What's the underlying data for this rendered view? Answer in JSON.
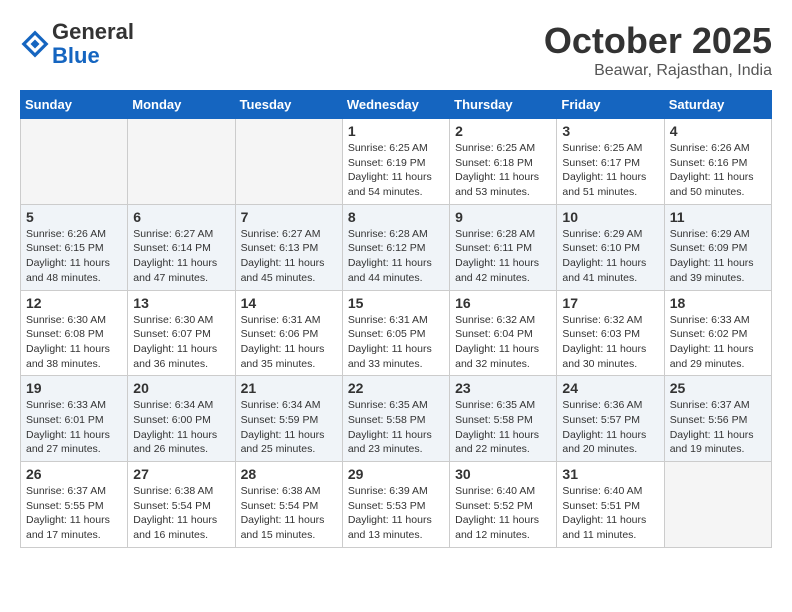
{
  "header": {
    "logo_general": "General",
    "logo_blue": "Blue",
    "month_title": "October 2025",
    "location": "Beawar, Rajasthan, India"
  },
  "weekdays": [
    "Sunday",
    "Monday",
    "Tuesday",
    "Wednesday",
    "Thursday",
    "Friday",
    "Saturday"
  ],
  "weeks": [
    [
      {
        "day": "",
        "info": ""
      },
      {
        "day": "",
        "info": ""
      },
      {
        "day": "",
        "info": ""
      },
      {
        "day": "1",
        "info": "Sunrise: 6:25 AM\nSunset: 6:19 PM\nDaylight: 11 hours\nand 54 minutes."
      },
      {
        "day": "2",
        "info": "Sunrise: 6:25 AM\nSunset: 6:18 PM\nDaylight: 11 hours\nand 53 minutes."
      },
      {
        "day": "3",
        "info": "Sunrise: 6:25 AM\nSunset: 6:17 PM\nDaylight: 11 hours\nand 51 minutes."
      },
      {
        "day": "4",
        "info": "Sunrise: 6:26 AM\nSunset: 6:16 PM\nDaylight: 11 hours\nand 50 minutes."
      }
    ],
    [
      {
        "day": "5",
        "info": "Sunrise: 6:26 AM\nSunset: 6:15 PM\nDaylight: 11 hours\nand 48 minutes."
      },
      {
        "day": "6",
        "info": "Sunrise: 6:27 AM\nSunset: 6:14 PM\nDaylight: 11 hours\nand 47 minutes."
      },
      {
        "day": "7",
        "info": "Sunrise: 6:27 AM\nSunset: 6:13 PM\nDaylight: 11 hours\nand 45 minutes."
      },
      {
        "day": "8",
        "info": "Sunrise: 6:28 AM\nSunset: 6:12 PM\nDaylight: 11 hours\nand 44 minutes."
      },
      {
        "day": "9",
        "info": "Sunrise: 6:28 AM\nSunset: 6:11 PM\nDaylight: 11 hours\nand 42 minutes."
      },
      {
        "day": "10",
        "info": "Sunrise: 6:29 AM\nSunset: 6:10 PM\nDaylight: 11 hours\nand 41 minutes."
      },
      {
        "day": "11",
        "info": "Sunrise: 6:29 AM\nSunset: 6:09 PM\nDaylight: 11 hours\nand 39 minutes."
      }
    ],
    [
      {
        "day": "12",
        "info": "Sunrise: 6:30 AM\nSunset: 6:08 PM\nDaylight: 11 hours\nand 38 minutes."
      },
      {
        "day": "13",
        "info": "Sunrise: 6:30 AM\nSunset: 6:07 PM\nDaylight: 11 hours\nand 36 minutes."
      },
      {
        "day": "14",
        "info": "Sunrise: 6:31 AM\nSunset: 6:06 PM\nDaylight: 11 hours\nand 35 minutes."
      },
      {
        "day": "15",
        "info": "Sunrise: 6:31 AM\nSunset: 6:05 PM\nDaylight: 11 hours\nand 33 minutes."
      },
      {
        "day": "16",
        "info": "Sunrise: 6:32 AM\nSunset: 6:04 PM\nDaylight: 11 hours\nand 32 minutes."
      },
      {
        "day": "17",
        "info": "Sunrise: 6:32 AM\nSunset: 6:03 PM\nDaylight: 11 hours\nand 30 minutes."
      },
      {
        "day": "18",
        "info": "Sunrise: 6:33 AM\nSunset: 6:02 PM\nDaylight: 11 hours\nand 29 minutes."
      }
    ],
    [
      {
        "day": "19",
        "info": "Sunrise: 6:33 AM\nSunset: 6:01 PM\nDaylight: 11 hours\nand 27 minutes."
      },
      {
        "day": "20",
        "info": "Sunrise: 6:34 AM\nSunset: 6:00 PM\nDaylight: 11 hours\nand 26 minutes."
      },
      {
        "day": "21",
        "info": "Sunrise: 6:34 AM\nSunset: 5:59 PM\nDaylight: 11 hours\nand 25 minutes."
      },
      {
        "day": "22",
        "info": "Sunrise: 6:35 AM\nSunset: 5:58 PM\nDaylight: 11 hours\nand 23 minutes."
      },
      {
        "day": "23",
        "info": "Sunrise: 6:35 AM\nSunset: 5:58 PM\nDaylight: 11 hours\nand 22 minutes."
      },
      {
        "day": "24",
        "info": "Sunrise: 6:36 AM\nSunset: 5:57 PM\nDaylight: 11 hours\nand 20 minutes."
      },
      {
        "day": "25",
        "info": "Sunrise: 6:37 AM\nSunset: 5:56 PM\nDaylight: 11 hours\nand 19 minutes."
      }
    ],
    [
      {
        "day": "26",
        "info": "Sunrise: 6:37 AM\nSunset: 5:55 PM\nDaylight: 11 hours\nand 17 minutes."
      },
      {
        "day": "27",
        "info": "Sunrise: 6:38 AM\nSunset: 5:54 PM\nDaylight: 11 hours\nand 16 minutes."
      },
      {
        "day": "28",
        "info": "Sunrise: 6:38 AM\nSunset: 5:54 PM\nDaylight: 11 hours\nand 15 minutes."
      },
      {
        "day": "29",
        "info": "Sunrise: 6:39 AM\nSunset: 5:53 PM\nDaylight: 11 hours\nand 13 minutes."
      },
      {
        "day": "30",
        "info": "Sunrise: 6:40 AM\nSunset: 5:52 PM\nDaylight: 11 hours\nand 12 minutes."
      },
      {
        "day": "31",
        "info": "Sunrise: 6:40 AM\nSunset: 5:51 PM\nDaylight: 11 hours\nand 11 minutes."
      },
      {
        "day": "",
        "info": ""
      }
    ]
  ]
}
